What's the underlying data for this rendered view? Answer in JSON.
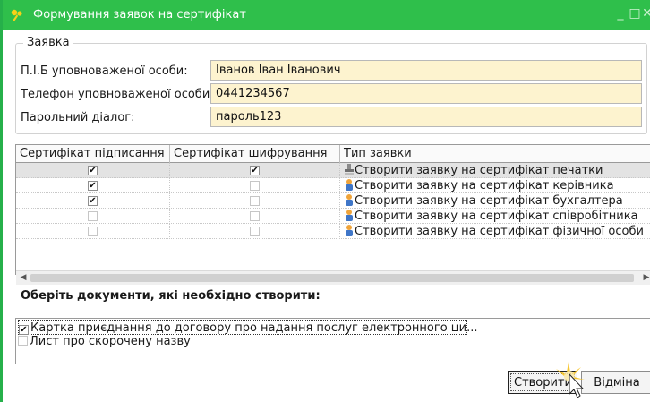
{
  "window": {
    "title": "Формування заявок на сертифікат",
    "accent": "#2fbf4b",
    "field_bg": "#fdf3cf",
    "controls": {
      "minimize": "_",
      "maximize": "□",
      "close": "✕"
    }
  },
  "request_group": {
    "legend": "Заявка",
    "fields": [
      {
        "label": "П.І.Б уповноваженої особи:",
        "value": "Іванов Іван Іванович"
      },
      {
        "label": "Телефон уповноваженої особи:",
        "value": "0441234567"
      },
      {
        "label": "Парольний діалог:",
        "value": "пароль123"
      }
    ]
  },
  "grid": {
    "columns": [
      "Сертифікат підписання",
      "Сертифікат шифрування",
      "Тип заявки"
    ],
    "rows": [
      {
        "sign": true,
        "encrypt": true,
        "type": "Створити заявку на сертифікат печатки",
        "icon": "stamp-icon",
        "selected": true
      },
      {
        "sign": true,
        "encrypt": false,
        "type": "Створити заявку на сертифікат керівника",
        "icon": "person-icon",
        "selected": false
      },
      {
        "sign": true,
        "encrypt": false,
        "type": "Створити заявку на сертифікат бухгалтера",
        "icon": "person-icon",
        "selected": false
      },
      {
        "sign": false,
        "encrypt": false,
        "type": "Створити заявку на сертифікат співробітника",
        "icon": "person-icon",
        "selected": false
      },
      {
        "sign": false,
        "encrypt": false,
        "type": "Створити заявку на сертифікат фізичної особи",
        "icon": "person-icon",
        "selected": false
      }
    ],
    "scroll_left": "◀",
    "scroll_right": "▶"
  },
  "documents": {
    "heading": "Оберіть документи, які необхідно створити:",
    "items": [
      {
        "label": "Картка приєднання до договору про надання послуг електронного ци...",
        "checked": true,
        "selected": true
      },
      {
        "label": "Лист про скорочену назву",
        "checked": false,
        "selected": false
      }
    ]
  },
  "buttons": {
    "create": "Створити",
    "cancel": "Відміна"
  },
  "check_mark": "✔"
}
